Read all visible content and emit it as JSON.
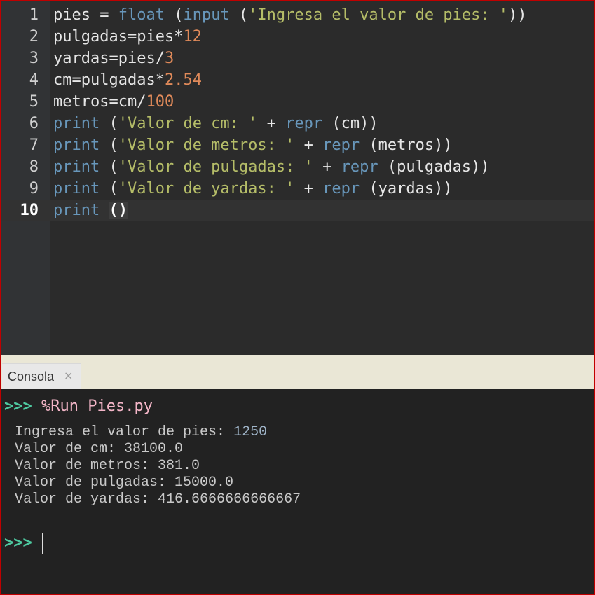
{
  "editor": {
    "lines": [
      {
        "num": "1",
        "parts": [
          {
            "t": "pies = ",
            "c": "plain"
          },
          {
            "t": "float",
            "c": "builtin"
          },
          {
            "t": " (",
            "c": "plain"
          },
          {
            "t": "input",
            "c": "builtin"
          },
          {
            "t": " (",
            "c": "plain"
          },
          {
            "t": "'Ingresa el valor de pies: '",
            "c": "str"
          },
          {
            "t": "))",
            "c": "plain"
          }
        ]
      },
      {
        "num": "2",
        "parts": [
          {
            "t": "pulgadas=pies*",
            "c": "plain"
          },
          {
            "t": "12",
            "c": "num"
          }
        ]
      },
      {
        "num": "3",
        "parts": [
          {
            "t": "yardas=pies/",
            "c": "plain"
          },
          {
            "t": "3",
            "c": "num"
          }
        ]
      },
      {
        "num": "4",
        "parts": [
          {
            "t": "cm=pulgadas*",
            "c": "plain"
          },
          {
            "t": "2.54",
            "c": "num"
          }
        ]
      },
      {
        "num": "5",
        "parts": [
          {
            "t": "metros=cm/",
            "c": "plain"
          },
          {
            "t": "100",
            "c": "num"
          }
        ]
      },
      {
        "num": "6",
        "parts": [
          {
            "t": "print",
            "c": "builtin"
          },
          {
            "t": " (",
            "c": "plain"
          },
          {
            "t": "'Valor de cm: '",
            "c": "str"
          },
          {
            "t": " + ",
            "c": "plain"
          },
          {
            "t": "repr",
            "c": "builtin"
          },
          {
            "t": " (cm))",
            "c": "plain"
          }
        ]
      },
      {
        "num": "7",
        "parts": [
          {
            "t": "print",
            "c": "builtin"
          },
          {
            "t": " (",
            "c": "plain"
          },
          {
            "t": "'Valor de metros: '",
            "c": "str"
          },
          {
            "t": " + ",
            "c": "plain"
          },
          {
            "t": "repr",
            "c": "builtin"
          },
          {
            "t": " (metros))",
            "c": "plain"
          }
        ]
      },
      {
        "num": "8",
        "parts": [
          {
            "t": "print",
            "c": "builtin"
          },
          {
            "t": " (",
            "c": "plain"
          },
          {
            "t": "'Valor de pulgadas: '",
            "c": "str"
          },
          {
            "t": " + ",
            "c": "plain"
          },
          {
            "t": "repr",
            "c": "builtin"
          },
          {
            "t": " (pulgadas))",
            "c": "plain"
          }
        ]
      },
      {
        "num": "9",
        "parts": [
          {
            "t": "print",
            "c": "builtin"
          },
          {
            "t": " (",
            "c": "plain"
          },
          {
            "t": "'Valor de yardas: '",
            "c": "str"
          },
          {
            "t": " + ",
            "c": "plain"
          },
          {
            "t": "repr",
            "c": "builtin"
          },
          {
            "t": " (yardas))",
            "c": "plain"
          }
        ]
      },
      {
        "num": "10",
        "current": true,
        "parts": [
          {
            "t": "print",
            "c": "builtin"
          },
          {
            "t": " ",
            "c": "plain"
          },
          {
            "t": "()",
            "c": "match"
          }
        ]
      }
    ]
  },
  "console_tab": {
    "label": "Consola",
    "close_icon": "×"
  },
  "console": {
    "prompt": ">>>",
    "run_command": "%Run Pies.py",
    "output": [
      {
        "label": "Ingresa el valor de pies: ",
        "value": "1250"
      },
      {
        "label": "Valor de cm: ",
        "value": "38100.0"
      },
      {
        "label": "Valor de metros: ",
        "value": "381.0"
      },
      {
        "label": "Valor de pulgadas: ",
        "value": "15000.0"
      },
      {
        "label": "Valor de yardas: ",
        "value": "416.6666666666667"
      }
    ],
    "second_prompt": ">>>"
  },
  "colors": {
    "accent_prompt": "#4ec9a0",
    "builtin": "#6897bb",
    "string": "#b5bd68",
    "number": "#e08a5a",
    "frame": "#c00000"
  }
}
